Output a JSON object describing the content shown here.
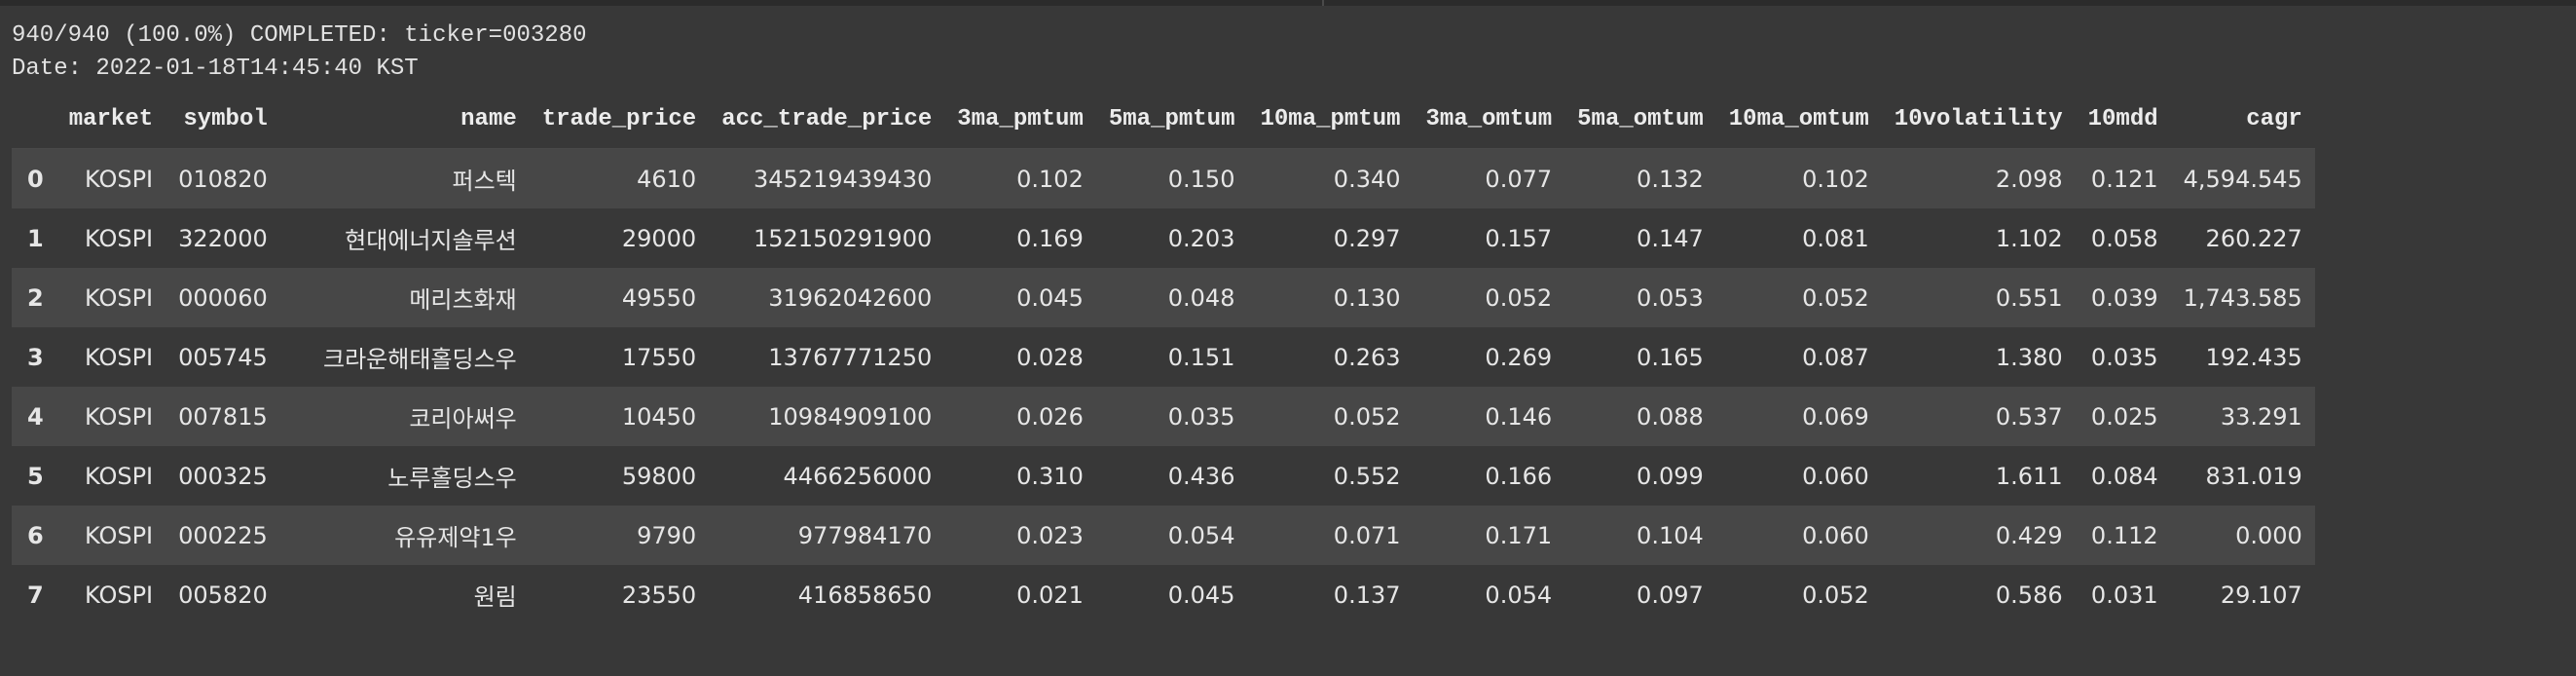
{
  "log": {
    "progress_line": "940/940 (100.0%) COMPLETED: ticker=003280",
    "date_line": "Date: 2022-01-18T14:45:40 KST"
  },
  "table": {
    "columns": [
      "",
      "market",
      "symbol",
      "name",
      "trade_price",
      "acc_trade_price",
      "3ma_pmtum",
      "5ma_pmtum",
      "10ma_pmtum",
      "3ma_omtum",
      "5ma_omtum",
      "10ma_omtum",
      "10volatility",
      "10mdd",
      "cagr"
    ],
    "rows": [
      [
        "0",
        "KOSPI",
        "010820",
        "퍼스텍",
        "4610",
        "345219439430",
        "0.102",
        "0.150",
        "0.340",
        "0.077",
        "0.132",
        "0.102",
        "2.098",
        "0.121",
        "4,594.545"
      ],
      [
        "1",
        "KOSPI",
        "322000",
        "현대에너지솔루션",
        "29000",
        "152150291900",
        "0.169",
        "0.203",
        "0.297",
        "0.157",
        "0.147",
        "0.081",
        "1.102",
        "0.058",
        "260.227"
      ],
      [
        "2",
        "KOSPI",
        "000060",
        "메리츠화재",
        "49550",
        "31962042600",
        "0.045",
        "0.048",
        "0.130",
        "0.052",
        "0.053",
        "0.052",
        "0.551",
        "0.039",
        "1,743.585"
      ],
      [
        "3",
        "KOSPI",
        "005745",
        "크라운해태홀딩스우",
        "17550",
        "13767771250",
        "0.028",
        "0.151",
        "0.263",
        "0.269",
        "0.165",
        "0.087",
        "1.380",
        "0.035",
        "192.435"
      ],
      [
        "4",
        "KOSPI",
        "007815",
        "코리아써우",
        "10450",
        "10984909100",
        "0.026",
        "0.035",
        "0.052",
        "0.146",
        "0.088",
        "0.069",
        "0.537",
        "0.025",
        "33.291"
      ],
      [
        "5",
        "KOSPI",
        "000325",
        "노루홀딩스우",
        "59800",
        "4466256000",
        "0.310",
        "0.436",
        "0.552",
        "0.166",
        "0.099",
        "0.060",
        "1.611",
        "0.084",
        "831.019"
      ],
      [
        "6",
        "KOSPI",
        "000225",
        "유유제약1우",
        "9790",
        "977984170",
        "0.023",
        "0.054",
        "0.071",
        "0.171",
        "0.104",
        "0.060",
        "0.429",
        "0.112",
        "0.000"
      ],
      [
        "7",
        "KOSPI",
        "005820",
        "원림",
        "23550",
        "416858650",
        "0.021",
        "0.045",
        "0.137",
        "0.054",
        "0.097",
        "0.052",
        "0.586",
        "0.031",
        "29.107"
      ]
    ]
  }
}
